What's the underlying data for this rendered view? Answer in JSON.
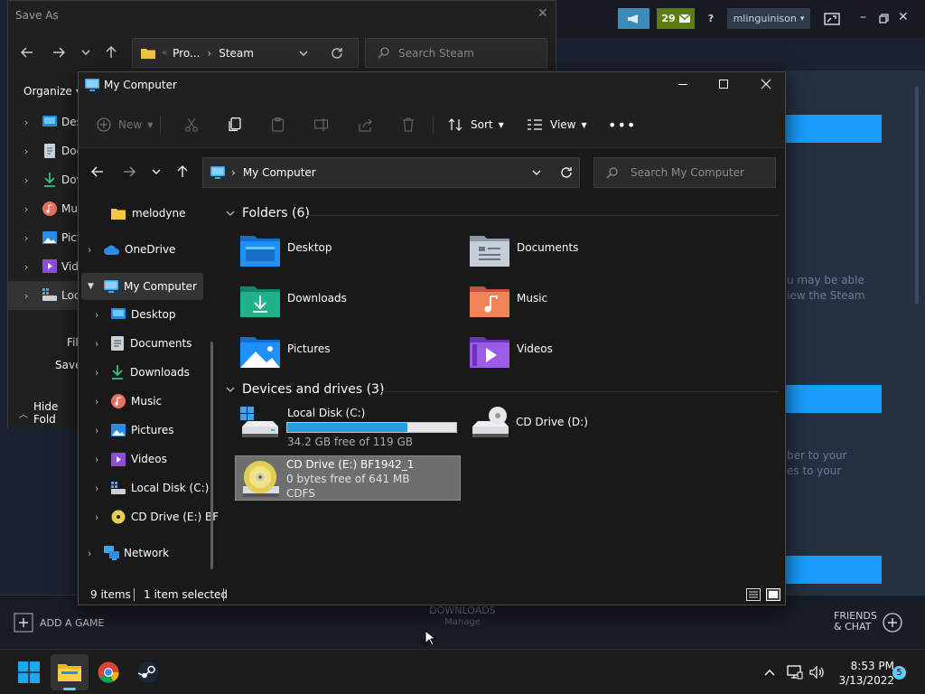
{
  "steam": {
    "broadcast_icon": "megaphone-icon",
    "notif_count": "29",
    "help": "?",
    "username": "mlinguinison",
    "faint_text_1": "u may be able",
    "faint_text_2": "iew the Steam",
    "faint_text_3": "ber to your",
    "faint_text_4": "es to your",
    "add_game": "ADD A GAME",
    "downloads": "DOWNLOADS",
    "downloads_sub": "Manage",
    "friends_line1": "FRIENDS",
    "friends_line2": "& CHAT"
  },
  "saveas": {
    "title": "Save As",
    "address": [
      "Pro...",
      "Steam"
    ],
    "search_placeholder": "Search Steam",
    "organize": "Organize",
    "nav_items": [
      "Des",
      "Doc",
      "Dov",
      "Mu",
      "Pict",
      "Vide",
      "Loc"
    ],
    "label_file": "Fil",
    "label_save": "Save",
    "hide_folders": "Hide Fold"
  },
  "explorer": {
    "title": "My Computer",
    "toolbar": {
      "new": "New",
      "sort": "Sort",
      "view": "View"
    },
    "address": "My Computer",
    "search_placeholder": "Search My Computer",
    "nav": {
      "pinned": "melodyne",
      "onedrive": "OneDrive",
      "mycomputer": "My Computer",
      "desktop": "Desktop",
      "documents": "Documents",
      "downloads": "Downloads",
      "music": "Music",
      "pictures": "Pictures",
      "videos": "Videos",
      "local_disk": "Local Disk (C:)",
      "cd_drive": "CD Drive (E:) BF",
      "network": "Network"
    },
    "folders_header": "Folders (6)",
    "folders": [
      "Desktop",
      "Documents",
      "Downloads",
      "Music",
      "Pictures",
      "Videos"
    ],
    "devices_header": "Devices and drives (3)",
    "drives": {
      "c_name": "Local Disk (C:)",
      "c_free": "34.2 GB free of 119 GB",
      "c_used_fraction": 0.713,
      "d_name": "CD Drive (D:)",
      "e_name": "CD Drive (E:) BF1942_1",
      "e_free": "0 bytes free of 641 MB",
      "e_fs": "CDFS"
    },
    "status": {
      "items": "9 items",
      "selected": "1 item selected"
    }
  },
  "taskbar": {
    "time": "8:53 PM",
    "date": "3/13/2022",
    "notifications": "5"
  }
}
